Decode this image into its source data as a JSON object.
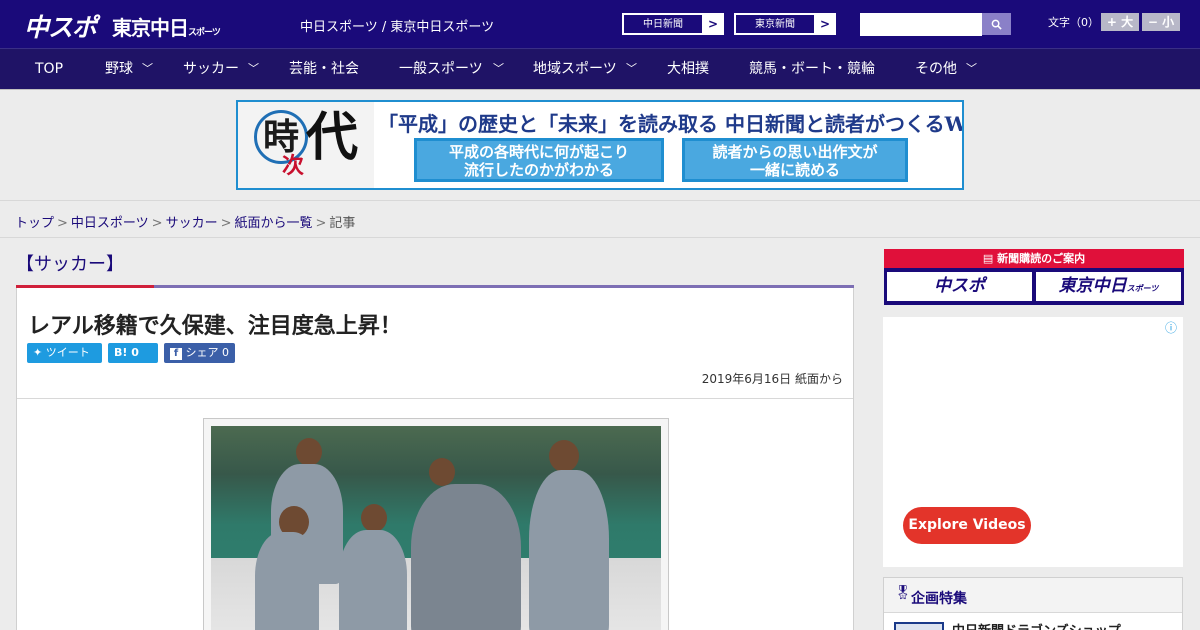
{
  "header": {
    "logo_chuspo": "中スポ",
    "logo_tokyo": "東京中日",
    "logo_tokyo_suffix": "スポーツ",
    "site_name": "中日スポーツ / 東京中日スポーツ",
    "paper_links": [
      "中日新聞",
      "東京新聞"
    ],
    "search_placeholder": "",
    "text_size_label": "文字（0）",
    "text_size_up": "+ 大",
    "text_size_down": "− 小"
  },
  "nav": {
    "items": [
      "TOP",
      "野球",
      "サッカー",
      "芸能・社会",
      "一般スポーツ",
      "地域スポーツ",
      "大相撲",
      "競馬・ボート・競輪",
      "その他"
    ]
  },
  "banner": {
    "char1": "時",
    "char2": "次",
    "char3": "代",
    "headline": "「平成」の歴史と「未来」を読み取る 中日新聞と読者がつくるWebサイト",
    "box1_line1": "平成の各時代に何が起こり",
    "box1_line2": "流行したのかがわかる",
    "box2_line1": "読者からの思い出作文が",
    "box2_line2": "一緒に読める"
  },
  "breadcrumb": [
    "トップ",
    "中日スポーツ",
    "サッカー",
    "紙面から一覧",
    "記事"
  ],
  "article": {
    "category": "【サッカー】",
    "title": "レアル移籍で久保建、注目度急上昇！",
    "share_tweet": "ツイート",
    "share_hatena": "B! 0",
    "share_facebook": "シェア 0",
    "date": "2019年6月16日 紙面から"
  },
  "sidebar": {
    "subscribe_header": "新聞購読のご案内",
    "subscribe_chuspo": "中スポ",
    "subscribe_tokyo": "東京中日",
    "subscribe_tokyo_suffix": "スポーツ",
    "ad_info": "ⓘ",
    "explore_videos": "Explore Videos",
    "special_header": "企画特集",
    "special_item": "中日新聞ドラゴンズショップ"
  },
  "colors": {
    "header_bg": "#1a0a7a",
    "nav_bg": "#1f1366",
    "accent_red": "#d0203a",
    "twitter": "#1e9be0",
    "facebook": "#3b5fa8"
  }
}
